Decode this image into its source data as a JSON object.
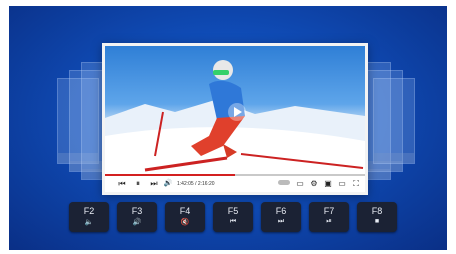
{
  "player": {
    "time": "1:42:05 / 2:16:20",
    "progress": 0.5
  },
  "controls": [
    {
      "name": "skip-back-icon",
      "glyph": "⏮"
    },
    {
      "name": "pause-icon",
      "glyph": "⏸"
    },
    {
      "name": "skip-forward-icon",
      "glyph": "⏭"
    },
    {
      "name": "volume-icon",
      "glyph": "🔊"
    }
  ],
  "right_controls": [
    {
      "name": "toggle-icon",
      "glyph": "●"
    },
    {
      "name": "subtitles-icon",
      "glyph": "▭"
    },
    {
      "name": "settings-icon",
      "glyph": "⚙"
    },
    {
      "name": "miniplayer-icon",
      "glyph": "▣"
    },
    {
      "name": "theater-icon",
      "glyph": "▭"
    },
    {
      "name": "fullscreen-icon",
      "glyph": "⛶"
    }
  ],
  "keys": [
    {
      "label": "F2",
      "symbol": "🔈"
    },
    {
      "label": "F3",
      "symbol": "🔊"
    },
    {
      "label": "F4",
      "symbol": "🔇"
    },
    {
      "label": "F5",
      "symbol": "⏮"
    },
    {
      "label": "F6",
      "symbol": "⏭"
    },
    {
      "label": "F7",
      "symbol": "⏯"
    },
    {
      "label": "F8",
      "symbol": "■"
    }
  ],
  "colors": {
    "accent": "#0f4bb5",
    "key": "#1b2234",
    "progress": "#d32020"
  }
}
